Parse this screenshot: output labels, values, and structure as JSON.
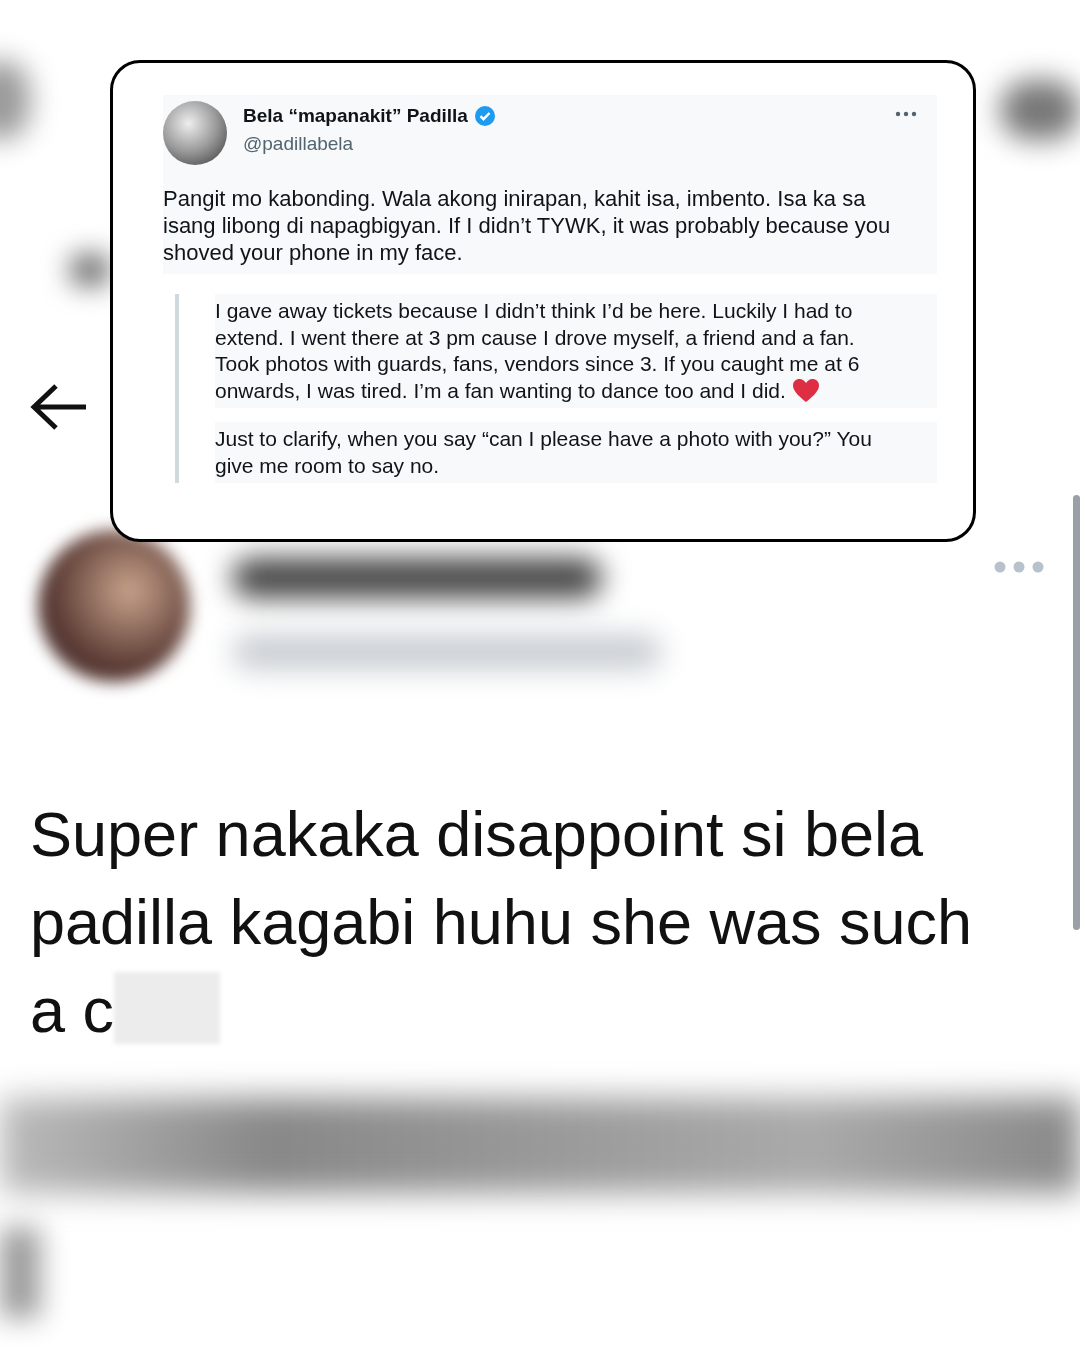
{
  "quoted_tweet": {
    "author_name": "Bela “mapanakit” Padilla",
    "verified": true,
    "handle": "@padillabela",
    "text": "Pangit mo kabonding. Wala akong inirapan, kahit isa, imbento. Isa ka sa isang libong di napagbigyan. If I didn’t TYWK, it was probably because you shoved your phone in my face.",
    "thread": [
      {
        "text": "I gave away tickets because I didn’t think I’d be here. Luckily I had to extend. I went there at 3 pm cause I drove myself, a friend and a fan. Took photos with guards, fans, vendors since 3. If you caught me at 6 onwards, I was tired. I’m a fan wanting to dance too and I did.",
        "heart": true
      },
      {
        "text": "Just to clarify, when you say “can I please have a photo with you?” You give me room to say no.",
        "heart": false
      }
    ]
  },
  "tweet": {
    "text": "Super nakaka disappoint si bela padilla kagabi huhu she was such a c",
    "censored": true
  }
}
